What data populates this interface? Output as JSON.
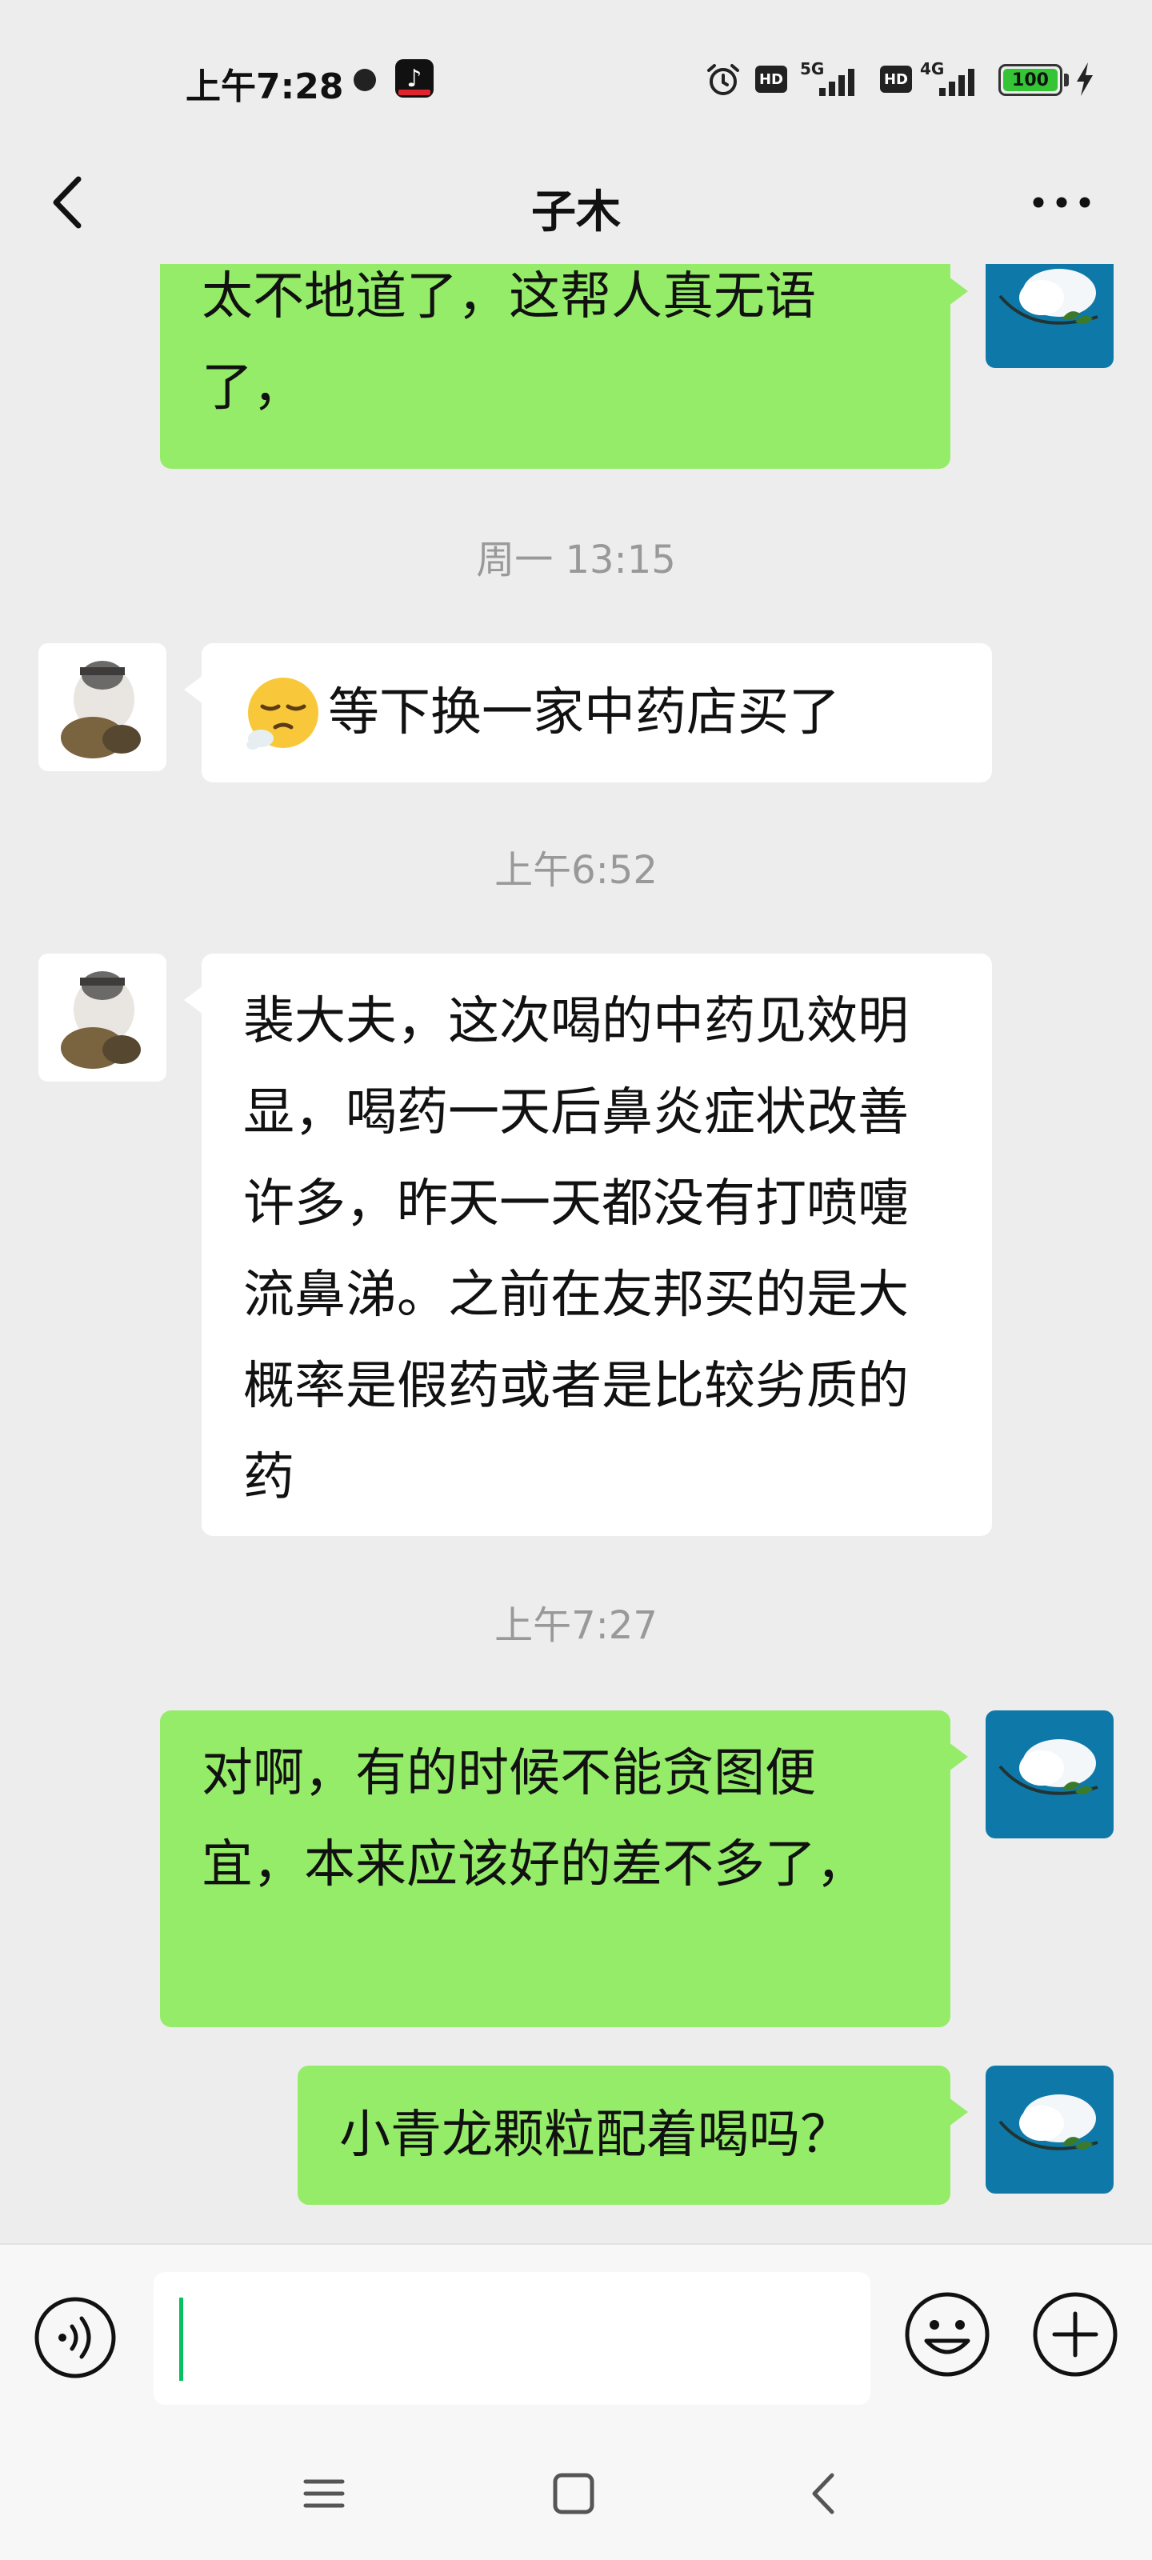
{
  "status_bar": {
    "time": "上午7:28",
    "network_1": "5G",
    "network_2": "4G",
    "hd_label": "HD",
    "battery": "100",
    "icons": [
      "dot-icon",
      "tiktok-icon",
      "alarm-icon",
      "signal-icon",
      "battery-icon",
      "charging-icon"
    ]
  },
  "nav": {
    "title": "子木",
    "icons": [
      "back-icon",
      "more-icon"
    ]
  },
  "messages": [
    {
      "type": "bubble",
      "sender": "me",
      "text": "太不地道了，这帮人真无语了，"
    },
    {
      "type": "timestamp",
      "text": "周一 13:15"
    },
    {
      "type": "bubble",
      "sender": "them",
      "emoji": "sighing-face-emoji",
      "text": "等下换一家中药店买了"
    },
    {
      "type": "timestamp",
      "text": "上午6:52"
    },
    {
      "type": "bubble",
      "sender": "them",
      "text": "裴大夫，这次喝的中药见效明显，喝药一天后鼻炎症状改善许多，昨天一天都没有打喷嚏流鼻涕。之前在友邦买的是大概率是假药或者是比较劣质的药"
    },
    {
      "type": "timestamp",
      "text": "上午7:27"
    },
    {
      "type": "bubble",
      "sender": "me",
      "text": "对啊，有的时候不能贪图便宜，本来应该好的差不多了，"
    },
    {
      "type": "bubble",
      "sender": "me",
      "text": "小青龙颗粒配着喝吗？"
    }
  ],
  "input_bar": {
    "value": "",
    "icons": [
      "voice-icon",
      "emoji-icon",
      "plus-icon"
    ]
  },
  "system_nav": {
    "icons": [
      "menu-icon",
      "home-icon",
      "back-nav-icon"
    ]
  },
  "colors": {
    "background": "#ededed",
    "my_bubble": "#95ec69",
    "their_bubble": "#ffffff",
    "timestamp": "#999999",
    "caret": "#07c160"
  }
}
